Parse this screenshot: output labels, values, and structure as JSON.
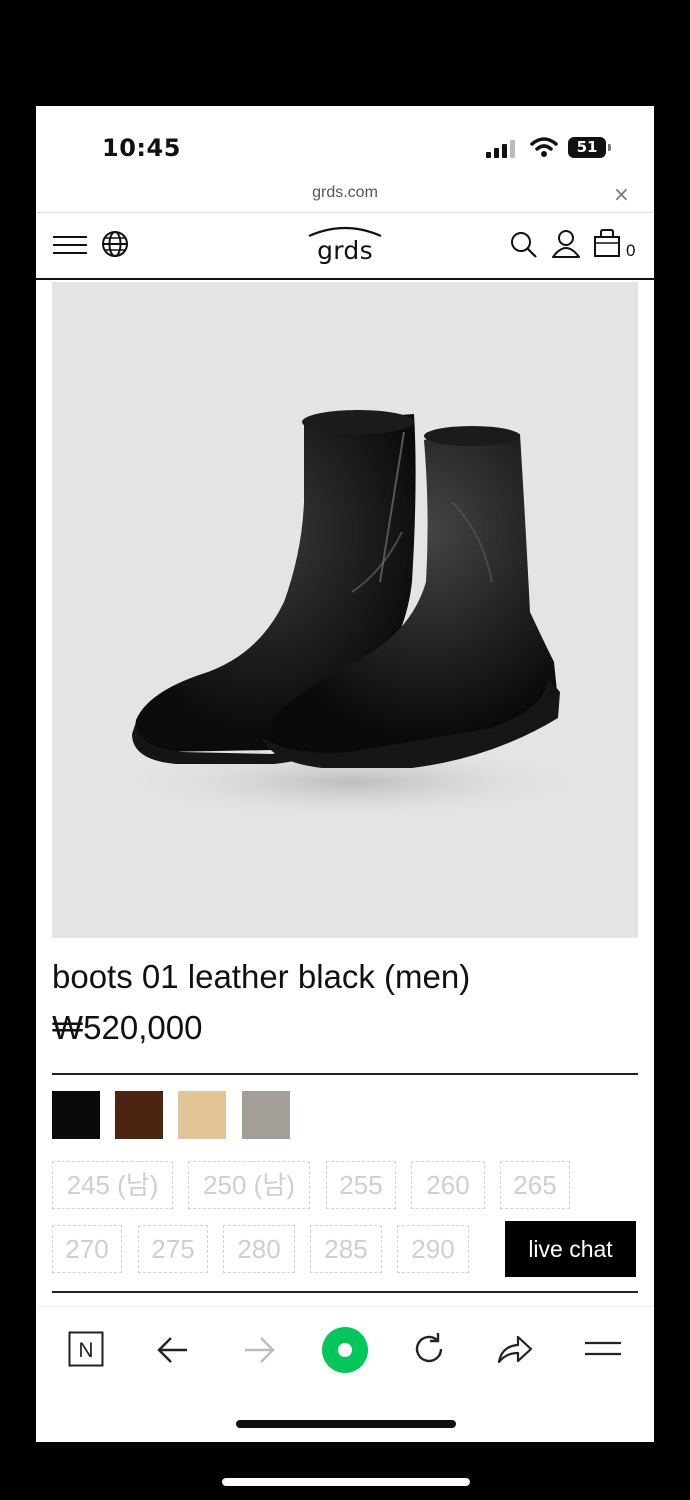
{
  "status_bar": {
    "time": "10:45",
    "battery": "51"
  },
  "browser": {
    "url": "grds.com",
    "close_glyph": "×"
  },
  "site_header": {
    "logo": "grds",
    "cart_count": "0",
    "icons": [
      "menu-icon",
      "globe-icon",
      "search-icon",
      "user-icon",
      "shopping-bag-icon"
    ]
  },
  "product": {
    "title": "boots 01 leather black (men)",
    "price": "₩520,000",
    "colors": [
      {
        "name": "black",
        "hex": "#0a0a0a"
      },
      {
        "name": "brown",
        "hex": "#4b2512"
      },
      {
        "name": "beige",
        "hex": "#e2c497"
      },
      {
        "name": "grey",
        "hex": "#a39f98"
      }
    ],
    "sizes": [
      "245 (남)",
      "250 (남)",
      "255",
      "260",
      "265",
      "270",
      "275",
      "280",
      "285",
      "290"
    ]
  },
  "live_chat_label": "live chat",
  "toolbar": {
    "icons": [
      "naver-n-icon",
      "back-arrow-icon",
      "forward-arrow-icon",
      "naver-green-circle-icon",
      "reload-icon",
      "share-icon",
      "menu-icon"
    ],
    "n_label": "N",
    "accent": "#03c75a"
  }
}
